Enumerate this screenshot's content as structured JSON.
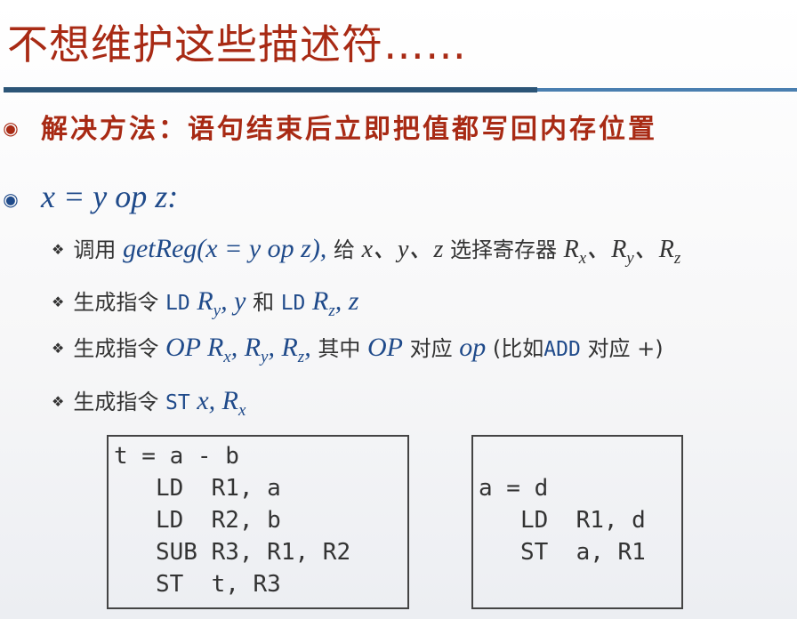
{
  "title": "不想维护这些描述符……",
  "bullet1": "解决方法：语句结束后立即把值都写回内存位置",
  "bullet2": "x = y op z:",
  "items": [
    {
      "prefix": "调用",
      "func": "getReg(x = y op z),",
      "middle": "给",
      "vars": "x、y、z",
      "suffix": "选择寄存器",
      "regs": [
        "R",
        "x",
        "、R",
        "y",
        "、R",
        "z"
      ]
    },
    {
      "prefix": "生成指令",
      "op1": "LD",
      "r1": "R",
      "r1sub": "y",
      "arg1": ", y",
      "and": "和",
      "op2": "LD",
      "r2": "R",
      "r2sub": "z",
      "arg2": ", z"
    },
    {
      "prefix": "生成指令",
      "opname": "OP",
      "regs": "R",
      "sx": "x",
      "sy": "y",
      "sz": "z",
      "comma": ",",
      "qizhong": "其中",
      "opname2": "OP",
      "duiying": "对应",
      "op": "op",
      "paren_open": "(比如",
      "add": "ADD",
      "duiying2": "对应",
      "plus": "+)"
    },
    {
      "prefix": "生成指令",
      "op": "ST",
      "var": "x,",
      "reg": "R",
      "regsub": "x"
    }
  ],
  "code_left": [
    "t = a - b",
    "   LD  R1, a",
    "   LD  R2, b",
    "   SUB R3, R1, R2",
    "   ST  t, R3"
  ],
  "code_right": [
    "a = d",
    "   LD  R1, d",
    "   ST  a, R1"
  ],
  "colors": {
    "title": "#a82a14",
    "rule": "#2c5577",
    "math": "#1f4a8a"
  },
  "icons": {
    "bullet": "circled-dot-icon",
    "sub_bullet": "diamond-icon"
  }
}
